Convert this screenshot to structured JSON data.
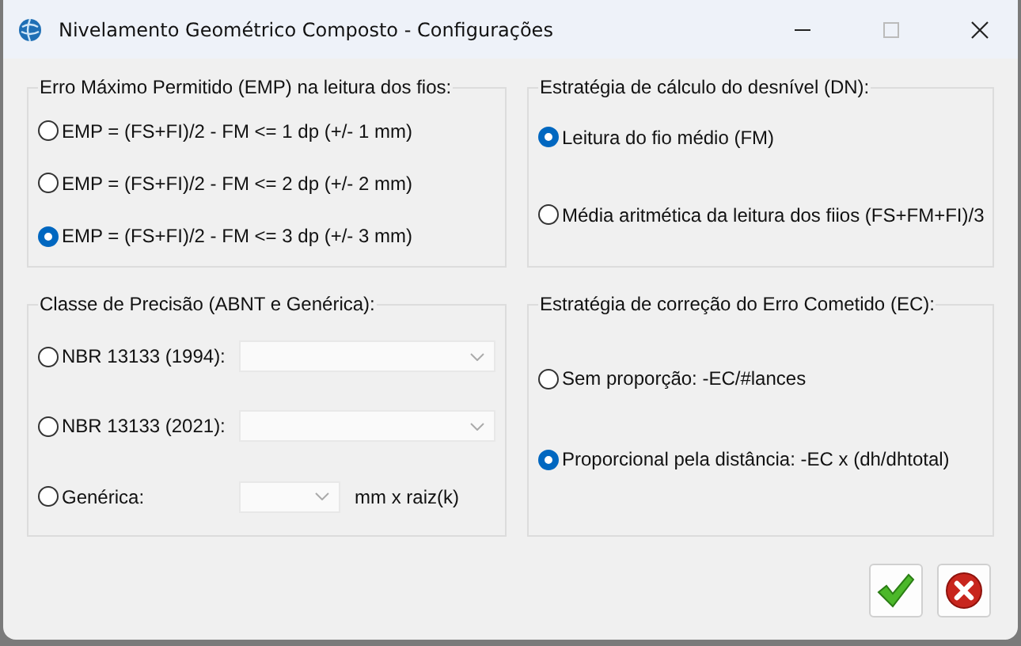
{
  "window": {
    "title": "Nivelamento Geométrico Composto - Configurações"
  },
  "groups": [
    {
      "legend": "Erro Máximo Permitido (EMP) na leitura dos fios:",
      "options": [
        {
          "kind": "radio",
          "label": "EMP = (FS+FI)/2 - FM <= 1 dp (+/- 1 mm)",
          "selected": false
        },
        {
          "kind": "radio",
          "label": "EMP = (FS+FI)/2 - FM <= 2 dp (+/- 2 mm)",
          "selected": false
        },
        {
          "kind": "radio",
          "label": "EMP = (FS+FI)/2 - FM <= 3 dp (+/- 3 mm)",
          "selected": true
        }
      ]
    },
    {
      "legend": "Estratégia de cálculo do desnível (DN):",
      "options": [
        {
          "kind": "radio",
          "label": "Leitura do fio médio (FM)",
          "selected": true
        },
        {
          "kind": "radio",
          "label": "Média aritmética da leitura dos fiios (FS+FM+FI)/3",
          "selected": false
        }
      ]
    },
    {
      "legend": "Classe de Precisão (ABNT e Genérica):",
      "options": [
        {
          "kind": "combo",
          "label": "NBR 13133 (1994):",
          "selected": false
        },
        {
          "kind": "combo",
          "label": "NBR 13133 (2021):",
          "selected": false
        },
        {
          "kind": "short_combo",
          "label": "Genérica:",
          "selected": false,
          "suffix": "mm x raiz(k)"
        }
      ]
    },
    {
      "legend": "Estratégia de correção do Erro Cometido (EC):",
      "options": [
        {
          "kind": "radio",
          "label": "Sem proporção: -EC/#lances",
          "selected": false
        },
        {
          "kind": "radio",
          "label": "Proporcional pela distância: -EC x (dh/dhtotal)",
          "selected": true
        }
      ]
    }
  ]
}
